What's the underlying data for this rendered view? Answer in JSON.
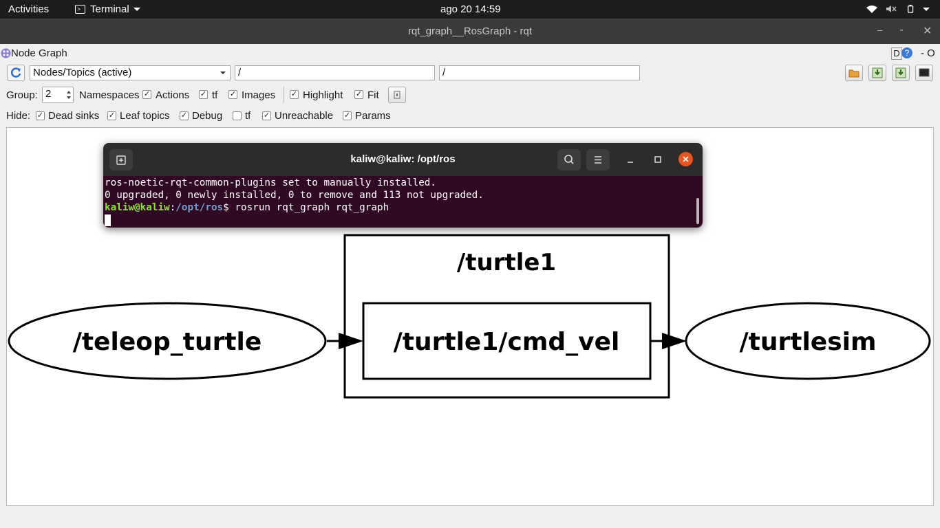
{
  "topbar": {
    "activities": "Activities",
    "app_menu": "Terminal",
    "clock": "ago 20  14:59"
  },
  "window": {
    "title": "rqt_graph__RosGraph - rqt",
    "plugin_title": "Node Graph",
    "plugin_controls": "D",
    "plugin_close": "- O"
  },
  "toolbar": {
    "graph_type": "Nodes/Topics (active)",
    "filter_nodes": "/",
    "filter_topics": "/"
  },
  "options": {
    "group_label": "Group:",
    "group_value": "2",
    "namespaces": "Namespaces",
    "actions": "Actions",
    "tf": "tf",
    "images": "Images",
    "highlight": "Highlight",
    "fit": "Fit"
  },
  "hide": {
    "label": "Hide:",
    "dead_sinks": "Dead sinks",
    "leaf_topics": "Leaf topics",
    "debug": "Debug",
    "tf": "tf",
    "unreachable": "Unreachable",
    "params": "Params"
  },
  "checks": {
    "actions": true,
    "tf": true,
    "images": true,
    "highlight": true,
    "fit": true,
    "dead_sinks": true,
    "leaf_topics": true,
    "debug": true,
    "hide_tf": false,
    "unreachable": true,
    "params": true
  },
  "graph": {
    "namespace": "/turtle1",
    "topic": "/turtle1/cmd_vel",
    "publisher": "/teleop_turtle",
    "subscriber": "/turtlesim"
  },
  "terminal": {
    "title": "kaliw@kaliw: /opt/ros",
    "line1": "ros-noetic-rqt-common-plugins set to manually installed.",
    "line2": "0 upgraded, 0 newly installed, 0 to remove and 113 not upgraded.",
    "prompt_user": "kaliw@kaliw",
    "prompt_sep": ":",
    "prompt_path": "/opt/ros",
    "prompt_end": "$ ",
    "command": "rosrun rqt_graph rqt_graph"
  },
  "colors": {
    "terminal_bg": "#300a24",
    "prompt_user": "#8ae234",
    "prompt_path": "#729fcf",
    "close_button": "#e95420"
  }
}
